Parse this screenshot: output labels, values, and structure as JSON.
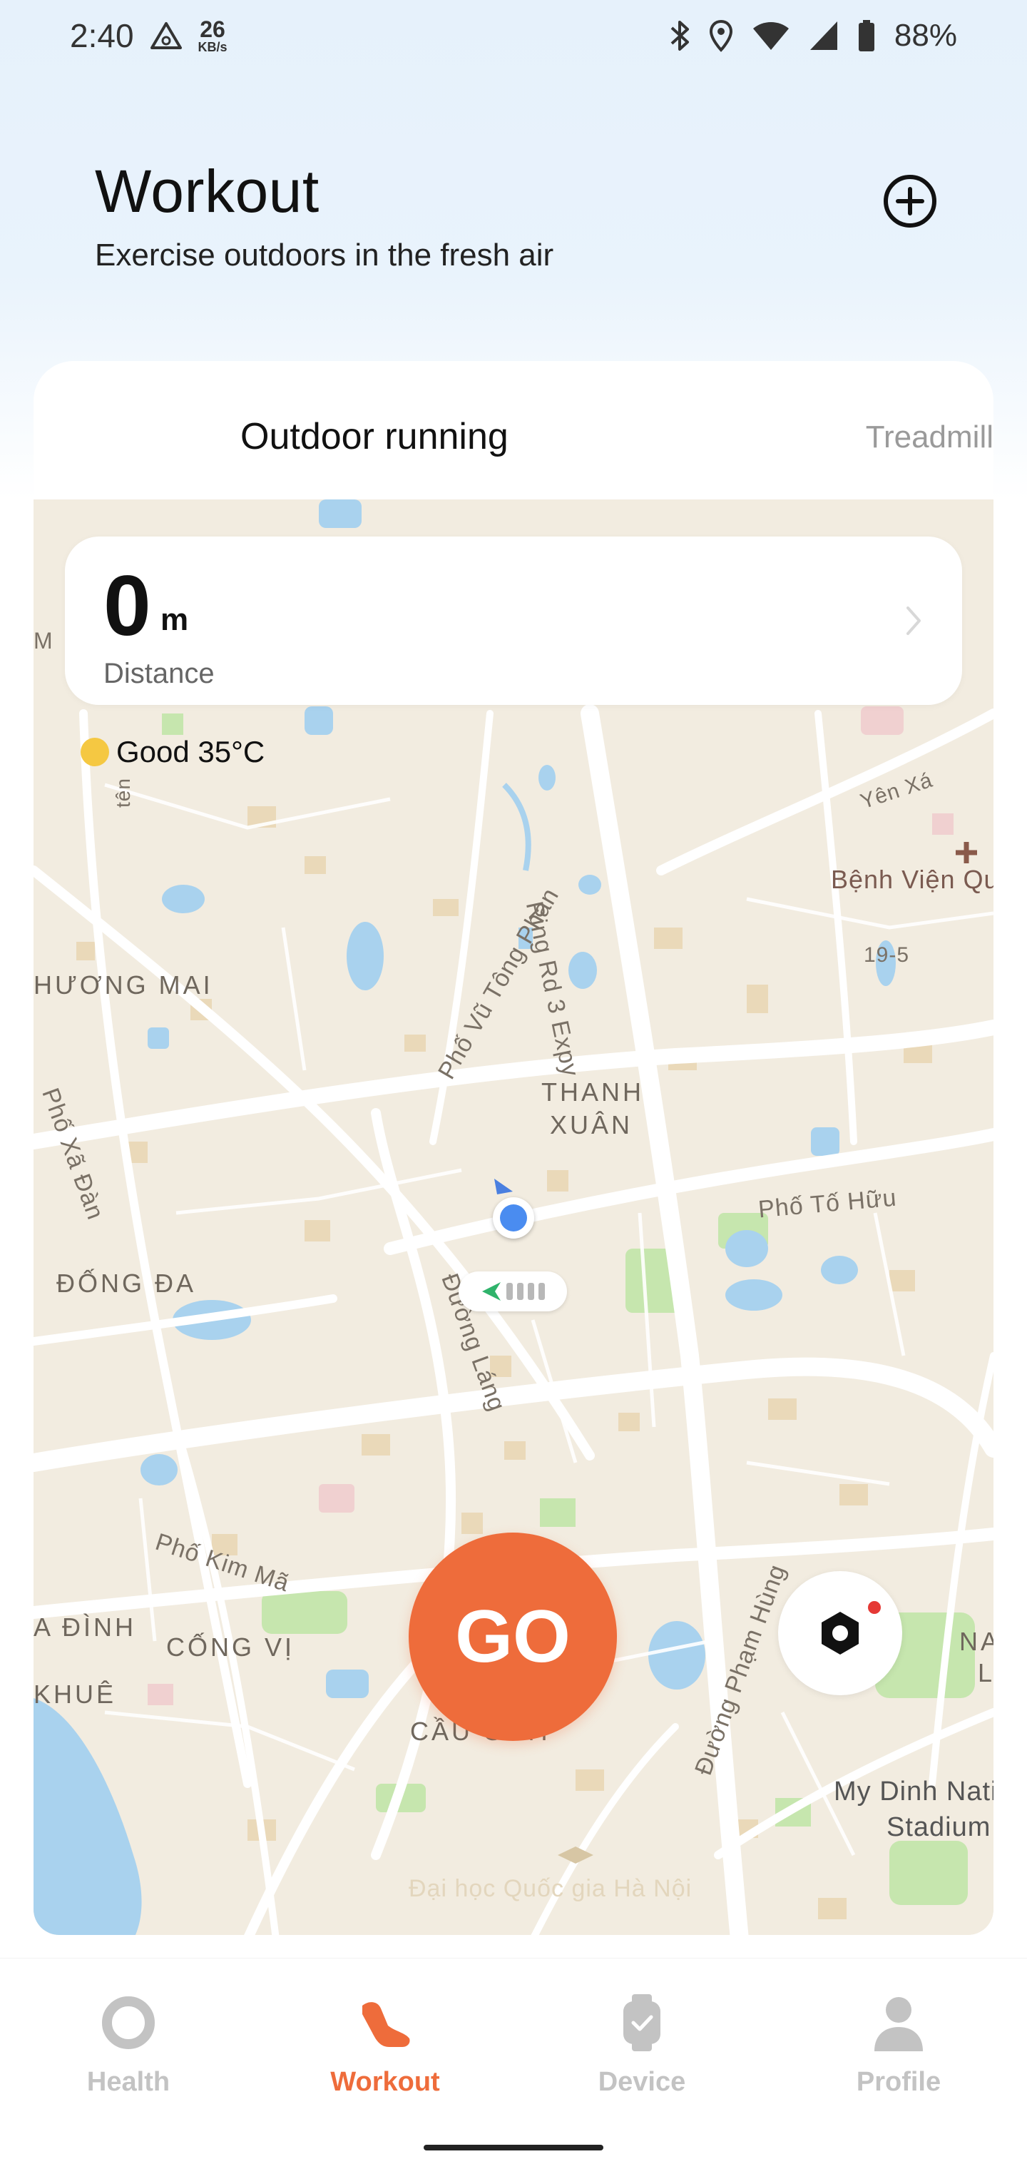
{
  "status_bar": {
    "time": "2:40",
    "speed_value": "26",
    "speed_unit": "KB/s",
    "battery": "88%",
    "icons": [
      "alert-triangle-icon",
      "bluetooth-icon",
      "location-icon",
      "wifi-icon",
      "signal-icon",
      "battery-icon"
    ]
  },
  "header": {
    "title": "Workout",
    "subtitle": "Exercise outdoors in the fresh air",
    "add_icon": "plus-circle-icon"
  },
  "tabs": {
    "active": "Outdoor running",
    "inactive": "Treadmill"
  },
  "distance": {
    "value": "0",
    "unit": "m",
    "label": "Distance"
  },
  "weather": {
    "text": "Good 35°C"
  },
  "map": {
    "labels": {
      "thanh": "THANH",
      "xuan": "XUÂN",
      "dong_da": "ĐỐNG ĐA",
      "huong_mai": "HƯƠNG MAI",
      "cau_giay": "CẦU GIẤY",
      "cong_vi": "CỐNG VỊ",
      "ba_dinh": "A ĐÌNH",
      "khue": "KHUÊ",
      "ring_road": "Ring Rd 3 Expy",
      "vu_tong_phan": "Phố Vũ Tông Phan",
      "to_huu": "Phố Tố Hữu",
      "duong_lang": "Đường Láng",
      "kim_ma": "Phố Kim Mã",
      "pham_hung": "Đường Phạm Hùng",
      "xa_dan": "Phố Xã Đàn",
      "yen_xa": "Yên Xá",
      "benh_vien": "Bệnh Viện Qu",
      "street_19_5": "19-5",
      "my_dinh_1": "My Dinh Nati",
      "my_dinh_2": "Stadium",
      "dai_hoc": "Đại học Quốc gia Hà Nội",
      "ten": "tên",
      "m": "M",
      "na": "NA",
      "l": "L"
    }
  },
  "actions": {
    "go_label": "GO",
    "settings_icon": "hexagon-settings-icon"
  },
  "nav": {
    "items": [
      {
        "label": "Health",
        "icon": "ring-icon"
      },
      {
        "label": "Workout",
        "icon": "shoe-icon"
      },
      {
        "label": "Device",
        "icon": "watch-icon"
      },
      {
        "label": "Profile",
        "icon": "person-icon"
      }
    ],
    "active_color": "#ee6c3b",
    "inactive_color": "#c3c3c3"
  },
  "colors": {
    "accent": "#ee6c3b",
    "map_bg": "#f2ece0",
    "water": "#a9d2ee",
    "park": "#bfe3a8"
  }
}
